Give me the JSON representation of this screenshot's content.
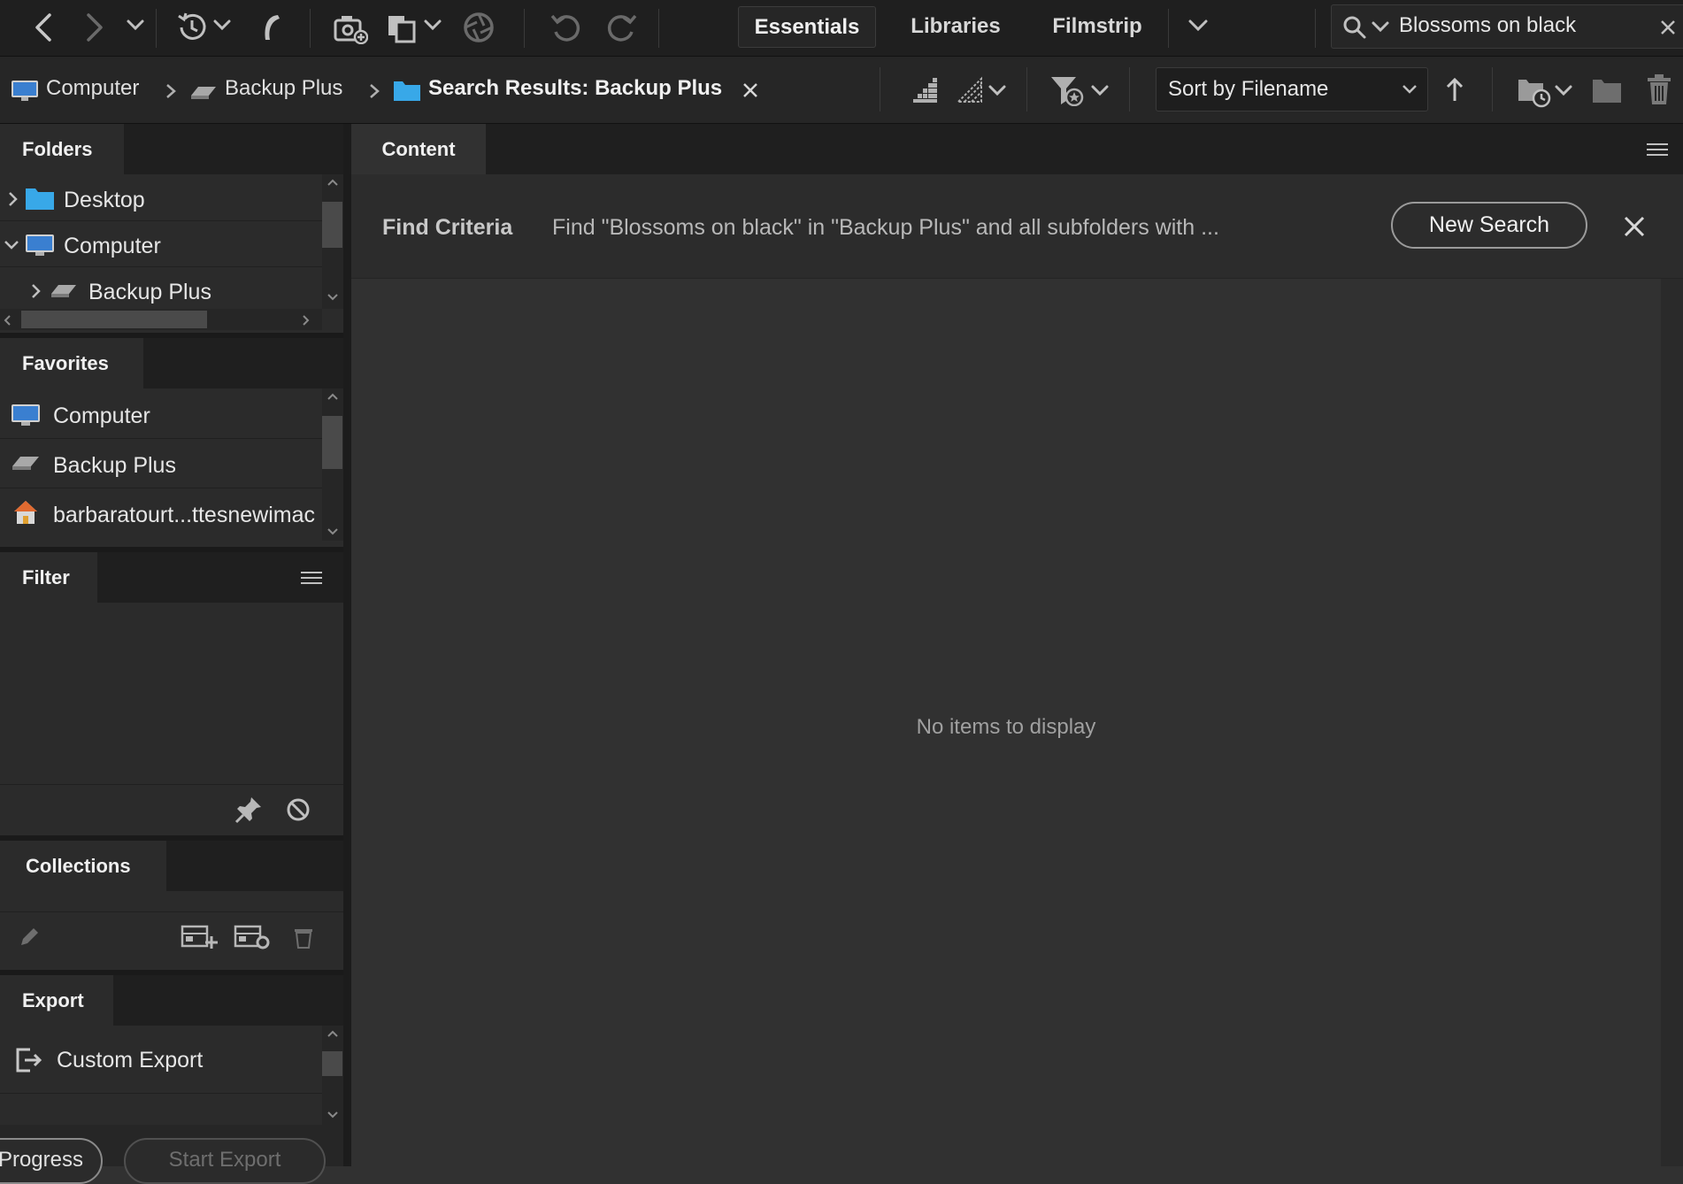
{
  "workspace_tabs": [
    "Essentials",
    "Libraries",
    "Filmstrip"
  ],
  "search": {
    "value": "Blossoms on black"
  },
  "breadcrumb": {
    "items": [
      "Computer",
      "Backup Plus"
    ],
    "current": "Search Results: Backup Plus"
  },
  "sort": {
    "label": "Sort by Filename"
  },
  "folders": {
    "title": "Folders",
    "items": [
      "Desktop",
      "Computer",
      "Backup Plus"
    ]
  },
  "favorites": {
    "title": "Favorites",
    "items": [
      "Computer",
      "Backup Plus",
      "barbaratourt...ttesnewimac"
    ]
  },
  "filter": {
    "title": "Filter"
  },
  "collections": {
    "title": "Collections"
  },
  "export": {
    "title": "Export",
    "items": [
      "Custom Export"
    ],
    "progress_button": "Progress",
    "start_button": "Start Export"
  },
  "content": {
    "tab": "Content",
    "find_criteria_label": "Find Criteria",
    "find_criteria_text": "Find \"Blossoms on black\" in \"Backup Plus\" and all subfolders with ...",
    "new_search_button": "New Search",
    "empty_message": "No items to display"
  },
  "colors": {
    "toolbar_bg": "#1f1f1f",
    "panel_bg": "#2b2b2b",
    "content_bg": "#313131",
    "folder_blue": "#38a8e8"
  },
  "icons": [
    "back-icon",
    "forward-icon",
    "recent-icon",
    "boomerang-icon",
    "camera-icon",
    "copy-icon",
    "aperture-icon",
    "undo-icon",
    "redo-icon",
    "search-icon",
    "quality-icon",
    "filter-icon",
    "sort-ascending-icon",
    "recent-folder-icon",
    "new-folder-icon",
    "trash-icon",
    "pin-icon",
    "clear-filter-icon",
    "edit-icon",
    "new-collection-icon",
    "smart-collection-icon",
    "export-icon"
  ]
}
